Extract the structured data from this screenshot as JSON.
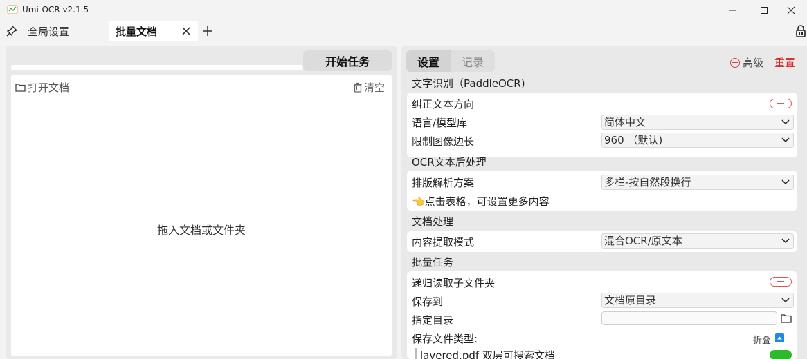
{
  "window": {
    "title": "Umi-OCR v2.1.5"
  },
  "tabs": [
    {
      "label": "全局设置"
    },
    {
      "label": "批量文档"
    }
  ],
  "left": {
    "start_label": "开始任务",
    "open_doc_label": "打开文档",
    "clear_label": "清空",
    "drop_hint": "拖入文档或文件夹",
    "progress": 0
  },
  "right": {
    "tabs": [
      {
        "label": "设置"
      },
      {
        "label": "记录"
      }
    ],
    "advanced_label": "高级",
    "reset_label": "重置",
    "sections": {
      "ocr": {
        "title": "文字识别（PaddleOCR)",
        "rows": {
          "correct_label": "纠正文本方向",
          "lang_label": "语言/模型库",
          "lang_value": "简体中文",
          "limit_label": "限制图像边长",
          "limit_value": "960 （默认)"
        }
      },
      "post": {
        "title": "OCR文本后处理",
        "rows": {
          "layout_label": "排版解析方案",
          "layout_value": "多栏-按自然段换行",
          "tip": "👈点击表格，可设置更多内容"
        }
      },
      "doc": {
        "title": "文档处理",
        "rows": {
          "extract_label": "内容提取模式",
          "extract_value": "混合OCR/原文本"
        }
      },
      "batch": {
        "title": "批量任务",
        "rows": {
          "recursive_label": "递归读取子文件夹",
          "save_to_label": "保存到",
          "save_to_value": "文档原目录",
          "dir_label": "指定目录",
          "dir_value": "",
          "filetype_label": "保存文件类型:",
          "fold_label": "折叠",
          "layered_pdf_label": "layered.pdf 双层可搜索文档"
        }
      }
    }
  },
  "colors": {
    "accent_red": "#e02020",
    "toggle_on": "#2eb82e",
    "fold_blue": "#1e88e5"
  }
}
